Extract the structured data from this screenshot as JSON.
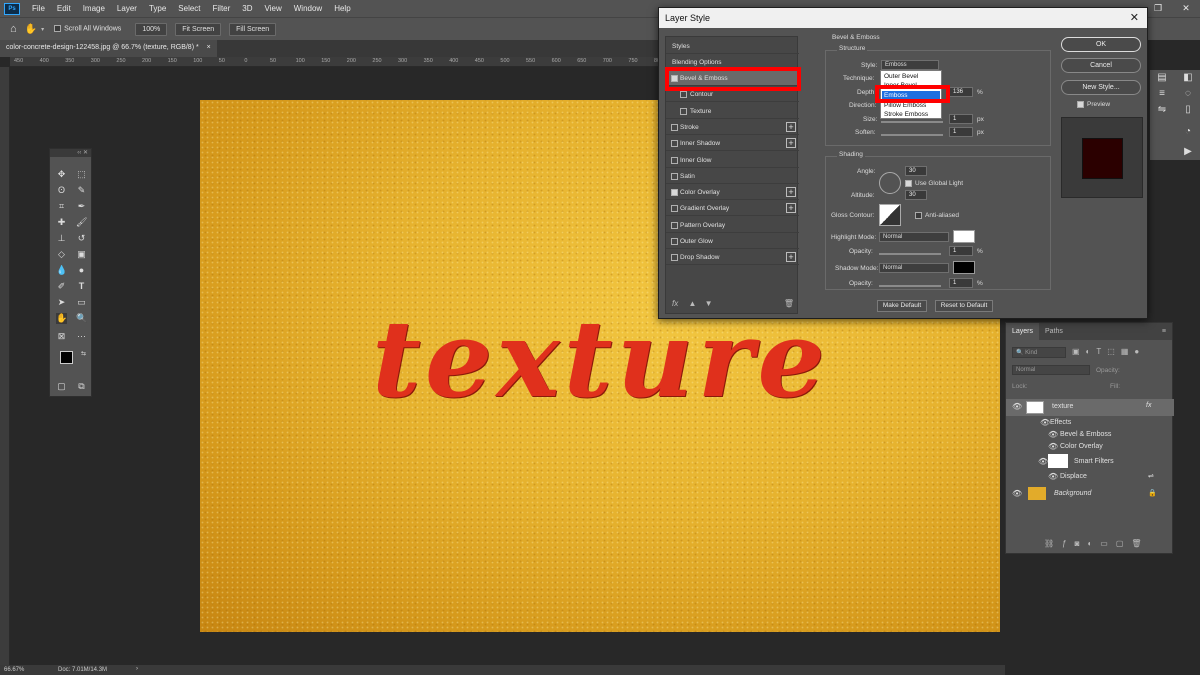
{
  "app": {
    "menus": [
      "File",
      "Edit",
      "Image",
      "Layer",
      "Type",
      "Select",
      "Filter",
      "3D",
      "View",
      "Window",
      "Help"
    ],
    "ps_badge": "Ps",
    "window_controls": [
      "—",
      "❐",
      "✕"
    ]
  },
  "options_bar": {
    "scroll_all_windows": "Scroll All Windows",
    "zoom_100": "100%",
    "fit_screen": "Fit Screen",
    "fill_screen": "Fill Screen"
  },
  "document": {
    "tab_title": "color-concrete-design-122458.jpg @ 66.7% (texture, RGB/8) *",
    "tab_close": "×",
    "canvas_text": "texture",
    "ruler_h": [
      "450",
      "400",
      "350",
      "300",
      "250",
      "200",
      "150",
      "100",
      "50",
      "0",
      "50",
      "100",
      "150",
      "200",
      "250",
      "300",
      "350",
      "400",
      "450",
      "500",
      "550",
      "600",
      "650",
      "700",
      "750",
      "800",
      "850",
      "900",
      "950",
      "1000",
      "1050",
      "1100",
      "1150",
      "1200",
      "1250",
      "1300",
      "1350",
      "1400",
      "1450"
    ]
  },
  "status_bar": {
    "zoom": "66.67%",
    "doc_size": "Doc: 7.01M/14.3M",
    "arrow": "›"
  },
  "layer_style_dialog": {
    "title": "Layer Style",
    "close": "✕",
    "styles_header": "Styles",
    "blending_options": "Blending Options",
    "style_items": [
      {
        "label": "Bevel & Emboss",
        "checked": true,
        "plus": false
      },
      {
        "label": "Contour",
        "checked": false,
        "plus": false,
        "indent": true
      },
      {
        "label": "Texture",
        "checked": false,
        "plus": false,
        "indent": true
      },
      {
        "label": "Stroke",
        "checked": false,
        "plus": true
      },
      {
        "label": "Inner Shadow",
        "checked": false,
        "plus": true
      },
      {
        "label": "Inner Glow",
        "checked": false,
        "plus": false
      },
      {
        "label": "Satin",
        "checked": false,
        "plus": false
      },
      {
        "label": "Color Overlay",
        "checked": true,
        "plus": true
      },
      {
        "label": "Gradient Overlay",
        "checked": false,
        "plus": true
      },
      {
        "label": "Pattern Overlay",
        "checked": false,
        "plus": false
      },
      {
        "label": "Outer Glow",
        "checked": false,
        "plus": false
      },
      {
        "label": "Drop Shadow",
        "checked": false,
        "plus": true
      }
    ],
    "footer_fx": "fx",
    "bevel": {
      "section_title": "Bevel & Emboss",
      "structure_title": "Structure",
      "style_label": "Style:",
      "style_value": "Emboss",
      "technique_label": "Technique:",
      "depth_label": "Depth:",
      "depth_value": "136",
      "depth_unit": "%",
      "direction_label": "Direction:",
      "size_label": "Size:",
      "size_value": "1",
      "size_unit": "px",
      "soften_label": "Soften:",
      "soften_value": "1",
      "soften_unit": "px",
      "shading_title": "Shading",
      "angle_label": "Angle:",
      "angle_value": "30",
      "use_global_light": "Use Global Light",
      "altitude_label": "Altitude:",
      "altitude_value": "30",
      "gloss_contour_label": "Gloss Contour:",
      "anti_aliased": "Anti-aliased",
      "highlight_mode_label": "Highlight Mode:",
      "highlight_mode_value": "Normal",
      "highlight_opacity_label": "Opacity:",
      "highlight_opacity_value": "1",
      "shadow_mode_label": "Shadow Mode:",
      "shadow_mode_value": "Normal",
      "shadow_opacity_label": "Opacity:",
      "shadow_opacity_value": "1",
      "percent": "%",
      "make_default": "Make Default",
      "reset_to_default": "Reset to Default",
      "highlight_color": "#ffffff",
      "shadow_color": "#000000"
    },
    "style_dropdown_options": [
      "Outer Bevel",
      "Inner Bevel",
      "Emboss",
      "Pillow Emboss",
      "Stroke Emboss"
    ],
    "style_dropdown_selected": "Emboss",
    "ok": "OK",
    "cancel": "Cancel",
    "new_style": "New Style...",
    "preview": "Preview",
    "preview_swatch": "#2b0000"
  },
  "layers_panel": {
    "tabs": [
      "Layers",
      "Paths"
    ],
    "kind": "Kind",
    "blend_mode": "Normal",
    "opacity_label": "Opacity:",
    "lock_label": "Lock:",
    "fill_label": "Fill:",
    "layers": [
      {
        "name": "texture",
        "fx": "fx"
      },
      {
        "name": "Effects"
      },
      {
        "name": "Bevel & Emboss"
      },
      {
        "name": "Color Overlay"
      },
      {
        "name": "Smart Filters"
      },
      {
        "name": "Displace"
      },
      {
        "name": "Background"
      }
    ]
  },
  "colors": {
    "accent_red": "#ff0000",
    "selection_blue": "#1e6fe0",
    "text_red": "#e0301c"
  }
}
